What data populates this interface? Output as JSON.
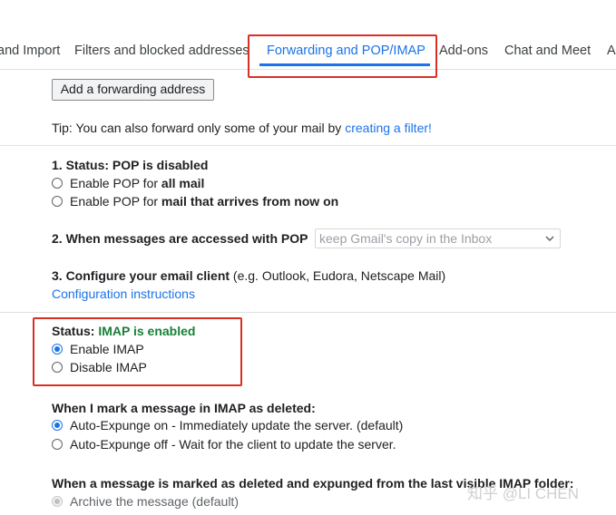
{
  "tabs": [
    {
      "label": "and Import"
    },
    {
      "label": "Filters and blocked addresses"
    },
    {
      "label": "Forwarding and POP/IMAP"
    },
    {
      "label": "Add-ons"
    },
    {
      "label": "Chat and Meet"
    },
    {
      "label": "A"
    }
  ],
  "forwarding": {
    "add_button": "Add a forwarding address",
    "tip_prefix": "Tip: You can also forward only some of your mail by ",
    "tip_link": "creating a filter!"
  },
  "pop": {
    "status_label": "1. Status: POP is disabled",
    "options": [
      {
        "prefix": "Enable POP for ",
        "bold": "all mail"
      },
      {
        "prefix": "Enable POP for ",
        "bold": "mail that arrives from now on"
      }
    ],
    "access_label": "2. When messages are accessed with POP",
    "access_select_value": "keep Gmail's copy in the Inbox",
    "configure_label": "3. Configure your email client",
    "configure_hint": " (e.g. Outlook, Eudora, Netscape Mail)",
    "config_link": "Configuration instructions"
  },
  "imap": {
    "status_prefix": "Status: ",
    "status_value": "IMAP is enabled",
    "options": [
      "Enable IMAP",
      "Disable IMAP"
    ],
    "deleted_label": "When I mark a message in IMAP as deleted:",
    "deleted_options": [
      "Auto-Expunge on - Immediately update the server. (default)",
      "Auto-Expunge off - Wait for the client to update the server."
    ],
    "expunged_label": "When a message is marked as deleted and expunged from the last visible IMAP folder:",
    "expunged_options": [
      "Archive the message (default)"
    ]
  },
  "watermark": "知乎 @LI CHEN",
  "colors": {
    "accent": "#1a73e8",
    "highlight": "#d93025",
    "enabled_green": "#188038"
  }
}
